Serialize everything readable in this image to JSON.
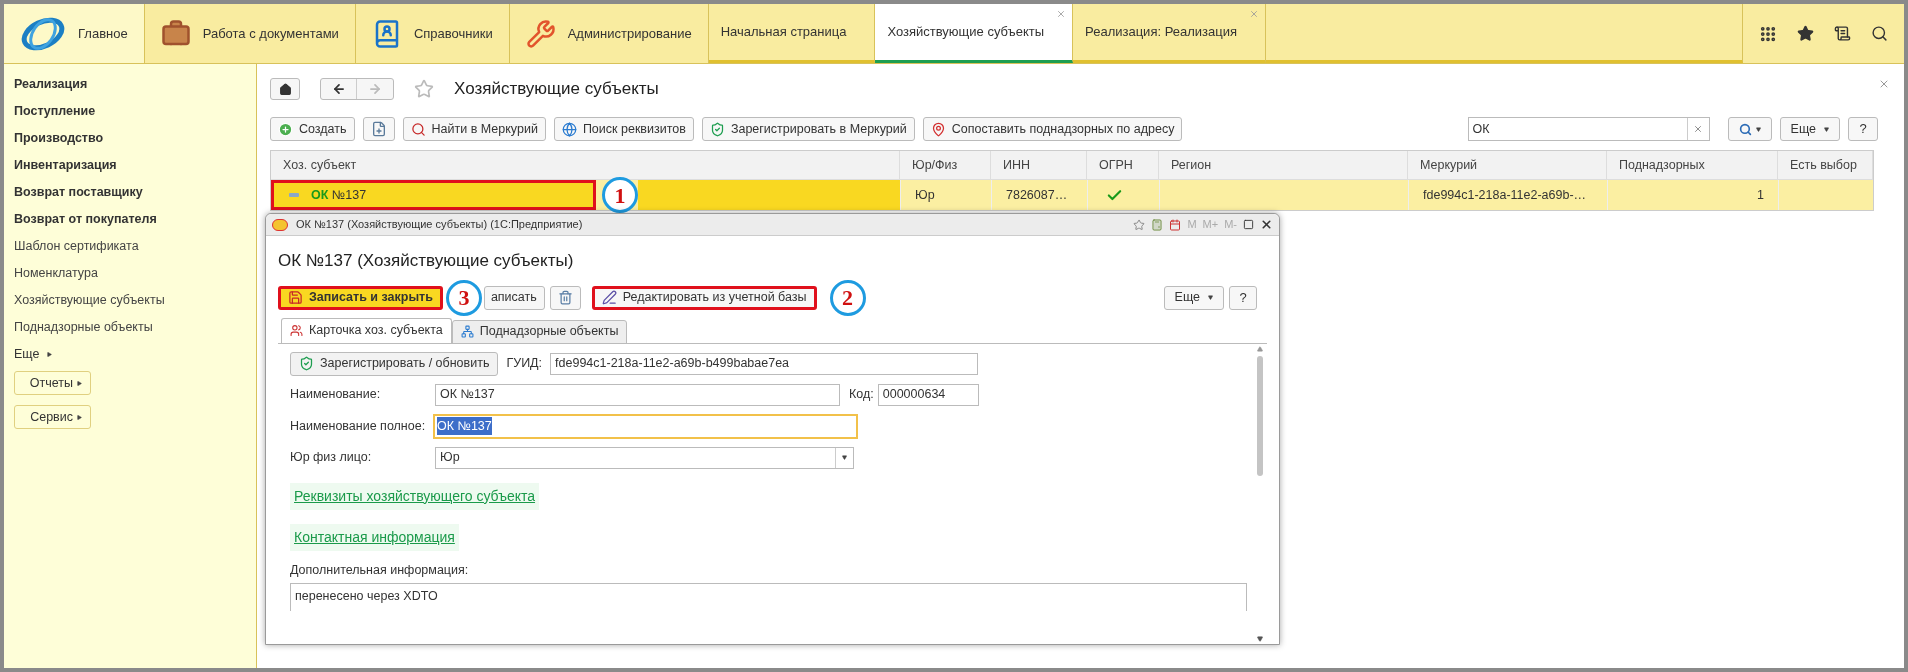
{
  "top_bar": {
    "sections": [
      {
        "label": "Главное",
        "kind": "home",
        "selected": true
      },
      {
        "label": "Работа с документами",
        "kind": "docs",
        "selected": false
      },
      {
        "label": "Справочники",
        "kind": "reference",
        "selected": false
      },
      {
        "label": "Администрирование",
        "kind": "admin",
        "selected": false
      }
    ],
    "tabs": [
      {
        "label": "Начальная страница",
        "selected": false,
        "closable": false
      },
      {
        "label": "Хозяйствующие субъекты",
        "selected": true,
        "closable": true
      },
      {
        "label": "Реализация: Реализация",
        "selected": false,
        "closable": true
      }
    ]
  },
  "sidebar": {
    "items": [
      {
        "label": "Реализация",
        "bold": true
      },
      {
        "label": "Поступление",
        "bold": true
      },
      {
        "label": "Производство",
        "bold": true
      },
      {
        "label": "Инвентаризация",
        "bold": true
      },
      {
        "label": "Возврат поставщику",
        "bold": true
      },
      {
        "label": "Возврат от покупателя",
        "bold": true
      },
      {
        "label": "Шаблон сертификата",
        "bold": false
      },
      {
        "label": "Номенклатура",
        "bold": false
      },
      {
        "label": "Хозяйствующие субъекты",
        "bold": false
      },
      {
        "label": "Поднадзорные объекты",
        "bold": false
      }
    ],
    "more": "Еще",
    "buttons": [
      "Отчеты",
      "Сервис"
    ]
  },
  "page": {
    "title": "Хозяйствующие субъекты",
    "toolbar": [
      {
        "label": "Создать",
        "kind": "create"
      },
      {
        "kind": "copy"
      },
      {
        "label": "Найти в Меркурий",
        "kind": "find"
      },
      {
        "label": "Поиск реквизитов",
        "kind": "lookup"
      },
      {
        "label": "Зарегистрировать в Меркурий",
        "kind": "register"
      },
      {
        "label": "Сопоставить поднадзорных по адресу",
        "kind": "map"
      }
    ],
    "search": {
      "value": "ОК"
    },
    "more": "Еще",
    "help": "?"
  },
  "table": {
    "columns": [
      "Хоз. субъект",
      "Юр/Физ",
      "ИНН",
      "ОГРН",
      "Регион",
      "Меркурий",
      "Поднадзорных",
      "Есть выбор"
    ],
    "rows": [
      {
        "selected": true,
        "subject": "**ОК** №137",
        "type": "Юр",
        "inn": "7826087…",
        "ogrn": true,
        "mercury": "fde994c1-218a-11e2-a69b-…",
        "supervised": "1",
        "callout": "1"
      }
    ]
  },
  "dialog": {
    "title": "ОК №137 (Хозяйствующие субъекты) (1С:Предприятие)",
    "memory": [
      "M",
      "M+",
      "M-"
    ],
    "heading": "ОК №137 (Хозяйствующие субъекты)",
    "toolbar": [
      {
        "label": "Записать и закрыть",
        "kind": "save_close",
        "callout": "3"
      },
      {
        "label": "аписать",
        "kind": "plain"
      },
      {
        "kind": "delete"
      },
      {
        "label": "Редактировать из учетной базы",
        "kind": "edit",
        "callout": "2"
      }
    ],
    "more": "Еще",
    "help": "?",
    "tabs": [
      {
        "label": "Карточка хоз. субъекта",
        "selected": true
      },
      {
        "label": "Поднадзорные объекты",
        "selected": false
      }
    ],
    "register_button": "Зарегистрировать / обновить",
    "guid": {
      "label": "ГУИД:",
      "value": "fde994c1-218a-11e2-a69b-b499babae7ea"
    },
    "name": {
      "label": "Наименование:",
      "value": "ОК №137"
    },
    "code": {
      "label": "Код:",
      "value": "000000634"
    },
    "full_name": {
      "label": "Наименование полное:",
      "value": "ОК №137",
      "focused": true,
      "text_selected": true
    },
    "entity_type": {
      "label": "Юр физ лицо:",
      "value": "Юр"
    },
    "links": [
      "Реквизиты хозяйствующего субъекта",
      "Контактная информация"
    ],
    "notes": {
      "label": "Дополнительная информация:",
      "value": "перенесено через XDTO"
    }
  }
}
